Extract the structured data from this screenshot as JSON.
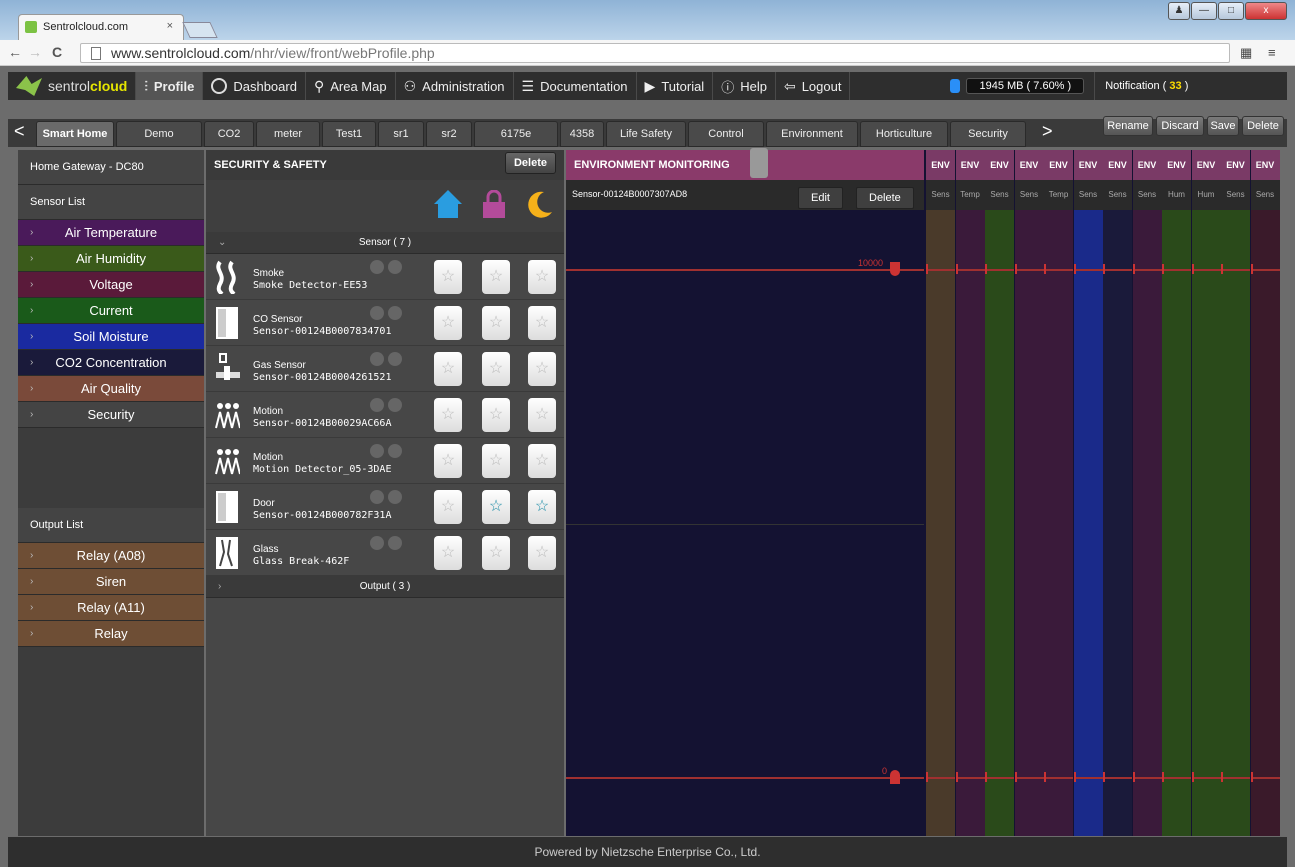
{
  "browser": {
    "tab_title": "Sentrolcloud.com",
    "tab_close": "×",
    "url_host": "www.sentrolcloud.com",
    "url_path": "/nhr/view/front/webProfile.php"
  },
  "topnav": {
    "brand_plain": "sentrol",
    "brand_bold": "cloud",
    "items": [
      "Profile",
      "Dashboard",
      "Area Map",
      "Administration",
      "Documentation",
      "Tutorial",
      "Help",
      "Logout"
    ],
    "memory": "1945 MB ( 7.60% )",
    "notification_label": "Notification (",
    "notification_count": "33",
    "notification_close": ")"
  },
  "profile_tabs": {
    "prev": "<",
    "next": ">",
    "tabs": [
      "Smart Home",
      "Demo",
      "CO2",
      "meter",
      "Test1",
      "sr1",
      "sr2",
      "6175e",
      "4358",
      "Life Safety",
      "Control",
      "Environment",
      "Horticulture",
      "Security"
    ],
    "actions": [
      "Rename",
      "Discard",
      "Save",
      "Delete"
    ]
  },
  "sidebar": {
    "gateway": "Home Gateway - DC80",
    "sensor_list_title": "Sensor List",
    "sensors": [
      {
        "label": "Air Temperature",
        "color": "#4a1a5a"
      },
      {
        "label": "Air Humidity",
        "color": "#3a5a1a"
      },
      {
        "label": "Voltage",
        "color": "#5a1a3a"
      },
      {
        "label": "Current",
        "color": "#1a5a1a"
      },
      {
        "label": "Soil Moisture",
        "color": "#1a2aa0"
      },
      {
        "label": "CO2 Concentration",
        "color": "#1a1a3a"
      },
      {
        "label": "Air Quality",
        "color": "#7a4a3a"
      },
      {
        "label": "Security",
        "color": "#444444"
      }
    ],
    "output_list_title": "Output List",
    "outputs": [
      "Relay (A08)",
      "Siren",
      "Relay (A11)",
      "Relay"
    ]
  },
  "security": {
    "title": "SECURITY & SAFETY",
    "delete": "Delete",
    "sensor_group": "Sensor ( 7 )",
    "output_group": "Output ( 3 )",
    "rows": [
      {
        "type": "Smoke",
        "name": "Smoke Detector-EE53",
        "icon": "smoke-icon",
        "stars": [
          false,
          false,
          false
        ]
      },
      {
        "type": "CO Sensor",
        "name": "Sensor-00124B0007834701",
        "icon": "door-icon",
        "stars": [
          false,
          false,
          false
        ]
      },
      {
        "type": "Gas Sensor",
        "name": "Sensor-00124B0004261521",
        "icon": "gas-valve-icon",
        "stars": [
          false,
          false,
          false
        ]
      },
      {
        "type": "Motion",
        "name": "Sensor-00124B00029AC66A",
        "icon": "motion-icon",
        "stars": [
          false,
          false,
          false
        ]
      },
      {
        "type": "Motion",
        "name": "Motion Detector_05-3DAE",
        "icon": "motion-icon",
        "stars": [
          false,
          false,
          false
        ]
      },
      {
        "type": "Door",
        "name": "Sensor-00124B000782F31A",
        "icon": "door-icon",
        "stars": [
          false,
          true,
          true
        ]
      },
      {
        "type": "Glass",
        "name": "Glass Break-462F",
        "icon": "glass-icon",
        "stars": [
          false,
          false,
          false
        ]
      }
    ],
    "star_glyph": "☆"
  },
  "env": {
    "title": "ENVIRONMENT MONITORING",
    "sensor": "Sensor-00124B0007307AD8",
    "edit": "Edit",
    "delete": "Delete",
    "upper_value": "10000",
    "lower_value": "0",
    "columns": [
      {
        "head": "ENV",
        "sub": "Sens",
        "color": "#4a3a2a"
      },
      {
        "head": "ENV",
        "sub": "Temp",
        "color": "#3a1a3a"
      },
      {
        "head": "ENV",
        "sub": "Sens",
        "color": "#2a4a1a"
      },
      {
        "head": "ENV",
        "sub": "Sens",
        "color": "#3a1a3a"
      },
      {
        "head": "ENV",
        "sub": "Temp",
        "color": "#3a1a3a"
      },
      {
        "head": "ENV",
        "sub": "Sens",
        "color": "#1a2a8a"
      },
      {
        "head": "ENV",
        "sub": "Sens",
        "color": "#1a1a3a"
      },
      {
        "head": "ENV",
        "sub": "Sens",
        "color": "#3a1a3a"
      },
      {
        "head": "ENV",
        "sub": "Hum",
        "color": "#2a4a1a"
      },
      {
        "head": "ENV",
        "sub": "Hum",
        "color": "#2a4a1a"
      },
      {
        "head": "ENV",
        "sub": "Sens",
        "color": "#2a4a1a"
      },
      {
        "head": "ENV",
        "sub": "Sens",
        "color": "#3a1a2a"
      }
    ]
  },
  "footer": "Powered by Nietzsche Enterprise Co., Ltd."
}
